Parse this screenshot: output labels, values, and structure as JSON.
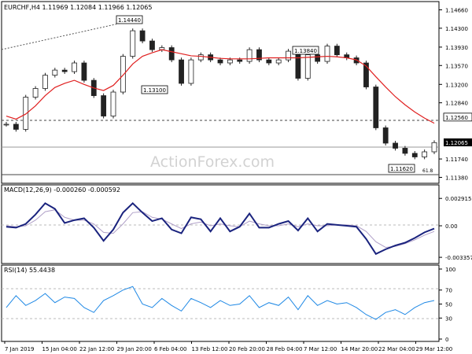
{
  "chart_data": [
    {
      "type": "candlestick",
      "panel": "price",
      "title": "EURCHF,H4  1.11969 1.12084 1.11966 1.12065",
      "ylim": [
        1.1131,
        1.1476
      ],
      "y_ticks": [
        "1.14660",
        "1.14300",
        "1.13930",
        "1.13570",
        "1.13200",
        "1.12840",
        "1.12560",
        "1.12065",
        "1.11740",
        "1.11380"
      ],
      "x_ticks": [
        "7 Jan 2019",
        "15 Jan 04:00",
        "22 Jan 12:00",
        "29 Jan 20:00",
        "6 Feb 04:00",
        "13 Feb 12:00",
        "20 Feb 20:00",
        "28 Feb 04:00",
        "7 Mar 12:00",
        "14 Mar 20:00",
        "22 Mar 04:00",
        "29 Mar 12:00"
      ],
      "series": [
        {
          "name": "EURCHF close",
          "values": [
            1.1242,
            1.1232,
            1.1295,
            1.1312,
            1.1338,
            1.1348,
            1.1345,
            1.1362,
            1.1328,
            1.1298,
            1.1258,
            1.1305,
            1.1375,
            1.1425,
            1.1405,
            1.1388,
            1.1392,
            1.1368,
            1.1322,
            1.1368,
            1.1378,
            1.1368,
            1.1362,
            1.1368,
            1.1365,
            1.1388,
            1.1368,
            1.1362,
            1.1368,
            1.1385,
            1.1332,
            1.1378,
            1.1365,
            1.1395,
            1.1378,
            1.1372,
            1.1362,
            1.1315,
            1.1235,
            1.1205,
            1.1195,
            1.1185,
            1.1178,
            1.1188,
            1.1206
          ]
        },
        {
          "name": "moving average",
          "values": [
            1.1258,
            1.1252,
            1.1262,
            1.1278,
            1.1298,
            1.1314,
            1.1322,
            1.1328,
            1.132,
            1.1313,
            1.1308,
            1.1318,
            1.1338,
            1.136,
            1.1375,
            1.1382,
            1.1388,
            1.1384,
            1.138,
            1.1376,
            1.1375,
            1.1373,
            1.1371,
            1.137,
            1.137,
            1.137,
            1.1371,
            1.1372,
            1.1372,
            1.1372,
            1.1372,
            1.1373,
            1.1374,
            1.1375,
            1.1374,
            1.1372,
            1.1368,
            1.1356,
            1.1335,
            1.1315,
            1.1296,
            1.128,
            1.1266,
            1.1254,
            1.1244
          ]
        }
      ],
      "annotations": [
        {
          "label": "1.14440",
          "value": 1.1444
        },
        {
          "label": "1.13100",
          "value": 1.131
        },
        {
          "label": "1.13840",
          "value": 1.1384
        },
        {
          "label": "1.11620",
          "value": 1.1162
        },
        {
          "label": "1.12560",
          "value": 1.1256
        },
        {
          "label": "61.8",
          "value": 1.1162
        }
      ],
      "current_price": "1.12065",
      "watermark": "ActionForex.com"
    },
    {
      "type": "line",
      "panel": "macd",
      "title": "MACD(12,26,9) -0.000260 -0.000592",
      "ylim": [
        -0.0036,
        0.0031
      ],
      "y_ticks": [
        "0.002915",
        "0.00",
        "-0.003357"
      ],
      "series": [
        {
          "name": "MACD",
          "values": [
            -0.0001,
            -0.0002,
            0.0002,
            0.0012,
            0.0024,
            0.0018,
            0.0003,
            0.0006,
            0.0008,
            -0.0002,
            -0.0016,
            -0.0004,
            0.0014,
            0.0024,
            0.0014,
            0.0005,
            0.0008,
            -0.0004,
            -0.0008,
            0.0009,
            0.0007,
            -0.0006,
            0.0008,
            -0.0006,
            -0.0001,
            0.0013,
            -0.0002,
            -0.0002,
            0.0002,
            0.0005,
            -0.0005,
            0.0008,
            -0.0006,
            0.0002,
            0.0001,
            0.0,
            -0.0001,
            -0.0014,
            -0.003,
            -0.0025,
            -0.0021,
            -0.0018,
            -0.0013,
            -0.0007,
            -0.0003
          ]
        },
        {
          "name": "Signal",
          "values": [
            0.0,
            -0.0001,
            0.0,
            0.0006,
            0.0015,
            0.0017,
            0.0009,
            0.0006,
            0.0006,
            0.0002,
            -0.0007,
            -0.0008,
            0.0002,
            0.0014,
            0.0015,
            0.0009,
            0.0007,
            0.0002,
            -0.0003,
            0.0002,
            0.0004,
            0.0,
            0.0002,
            0.0,
            -0.0001,
            0.0005,
            0.0002,
            0.0,
            0.0,
            0.0002,
            -0.0001,
            0.0002,
            0.0,
            0.0,
            0.0001,
            0.0001,
            0.0,
            -0.0006,
            -0.0017,
            -0.0023,
            -0.0022,
            -0.0019,
            -0.0015,
            -0.001,
            -0.0006
          ]
        }
      ]
    },
    {
      "type": "line",
      "panel": "rsi",
      "title": "RSI(14) 55.4438",
      "ylim": [
        0,
        100
      ],
      "y_ticks": [
        "100",
        "70",
        "50",
        "30",
        "0"
      ],
      "series": [
        {
          "name": "RSI",
          "values": [
            45,
            62,
            48,
            55,
            65,
            52,
            60,
            58,
            45,
            38,
            55,
            62,
            70,
            75,
            50,
            45,
            58,
            48,
            40,
            58,
            52,
            45,
            55,
            48,
            50,
            62,
            45,
            52,
            48,
            60,
            42,
            62,
            48,
            55,
            50,
            52,
            45,
            35,
            28,
            38,
            42,
            35,
            45,
            52,
            55
          ]
        }
      ]
    }
  ]
}
